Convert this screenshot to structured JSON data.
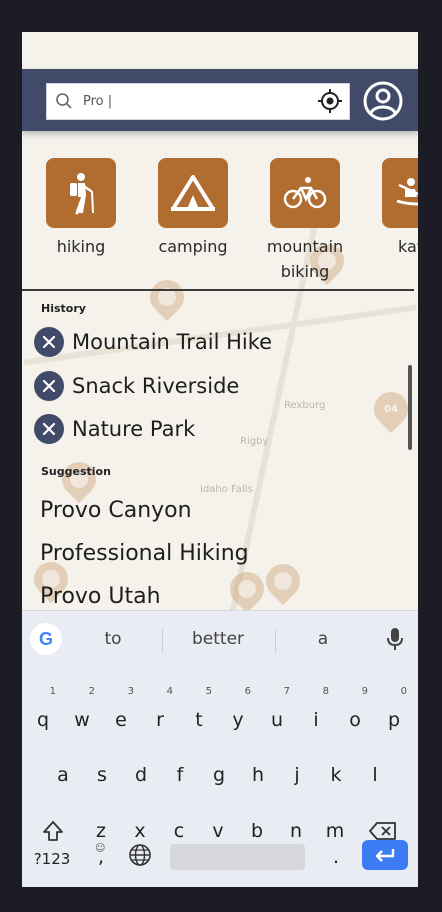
{
  "search": {
    "value": "Pro |"
  },
  "categories": [
    {
      "label": "hiking"
    },
    {
      "label": "camping"
    },
    {
      "label": "mountain biking"
    },
    {
      "label": "kaya"
    }
  ],
  "map": {
    "marker_04": "04",
    "places": [
      "Rexburg",
      "Rigby",
      "Idaho Falls"
    ]
  },
  "history": {
    "title": "History",
    "items": [
      "Mountain Trail Hike",
      "Snack Riverside",
      "Nature Park"
    ]
  },
  "suggestion": {
    "title": "Suggestion",
    "items": [
      "Provo Canyon",
      "Professional Hiking",
      "Provo Utah"
    ]
  },
  "keyboard": {
    "suggestions": [
      "to",
      "better",
      "a"
    ],
    "row1": [
      "q",
      "w",
      "e",
      "r",
      "t",
      "y",
      "u",
      "i",
      "o",
      "p"
    ],
    "row1_hints": [
      "1",
      "2",
      "3",
      "4",
      "5",
      "6",
      "7",
      "8",
      "9",
      "0"
    ],
    "row2": [
      "a",
      "s",
      "d",
      "f",
      "g",
      "h",
      "j",
      "k",
      "l"
    ],
    "row3": [
      "z",
      "x",
      "c",
      "v",
      "b",
      "n",
      "m"
    ],
    "symbols_label": "?123",
    "comma_label": ",",
    "period_label": "."
  },
  "colors": {
    "header": "#424a69",
    "tile": "#b06d2f",
    "enter": "#3b7cf5"
  }
}
